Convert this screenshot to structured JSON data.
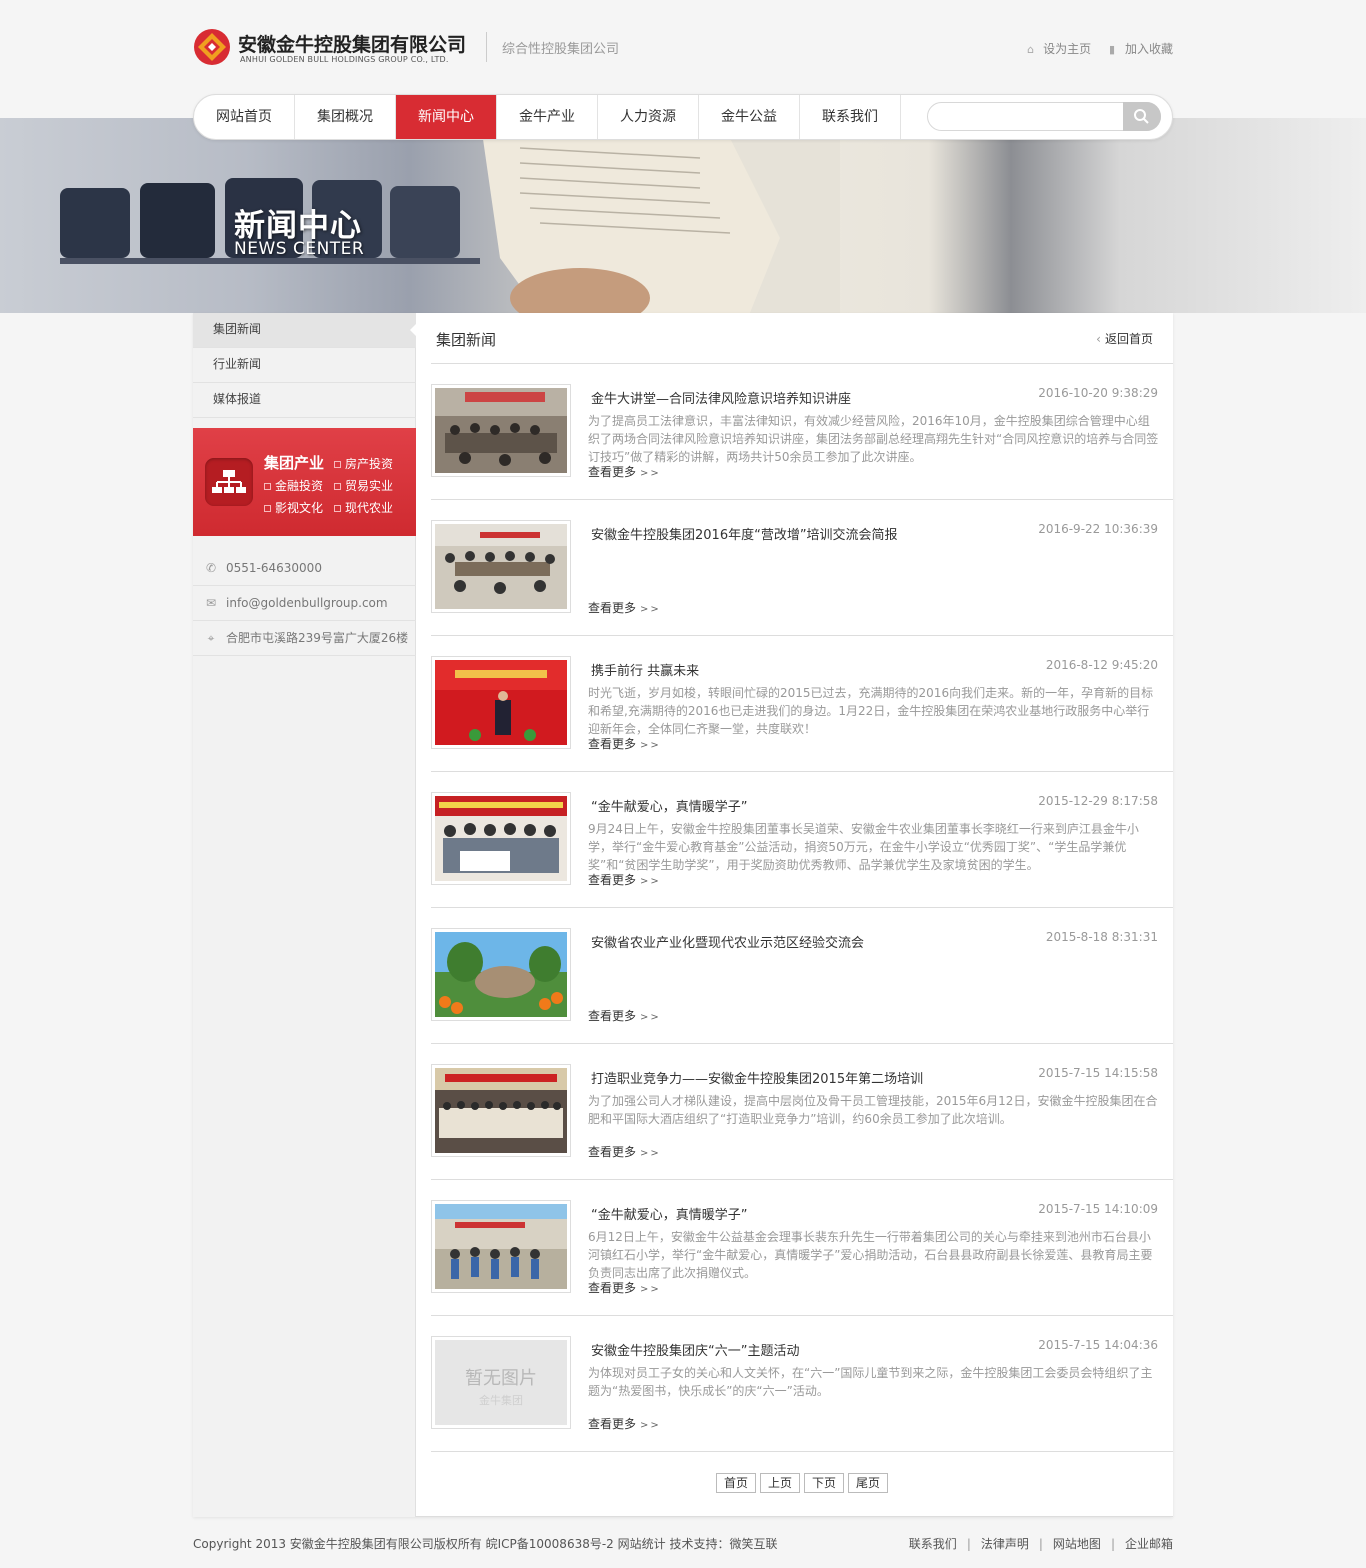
{
  "header": {
    "company_cn": "安徽金牛控股集团有限公司",
    "company_en": "ANHUI GOLDEN BULL HOLDINGS GROUP CO., LTD.",
    "slogan": "综合性控股集团公司",
    "set_home": "设为主页",
    "add_favorite": "加入收藏"
  },
  "nav": {
    "items": [
      "网站首页",
      "集团概况",
      "新闻中心",
      "金牛产业",
      "人力资源",
      "金牛公益",
      "联系我们"
    ],
    "active_index": 2,
    "search_placeholder": "",
    "accent_color": "#d82c33"
  },
  "banner": {
    "title": "新闻中心",
    "subtitle": "NEWS CENTER"
  },
  "sidebar": {
    "items": [
      "集团新闻",
      "行业新闻",
      "媒体报道"
    ],
    "active_index": 0,
    "industry": {
      "title": "集团产业",
      "links": [
        "房产投资",
        "金融投资",
        "贸易实业",
        "影视文化",
        "现代农业"
      ]
    },
    "contact": {
      "phone": "0551-64630000",
      "email": "info@goldenbullgroup.com",
      "address": "合肥市屯溪路239号富广大厦26楼"
    }
  },
  "content": {
    "section_title": "集团新闻",
    "back_home": "返回首页",
    "more_label": "查看更多",
    "news": [
      {
        "title": "金牛大讲堂—合同法律风险意识培养知识讲座",
        "date": "2016-10-20 9:38:29",
        "summary": "为了提高员工法律意识，丰富法律知识，有效减少经营风险，2016年10月，金牛控股集团综合管理中心组织了两场合同法律风险意识培养知识讲座，集团法务部副总经理高翔先生针对“合同风控意识的培养与合同签订技巧”做了精彩的讲解，两场共计50余员工参加了此次讲座。",
        "thumb": "meeting-room"
      },
      {
        "title": "安徽金牛控股集团2016年度“营改增”培训交流会简报",
        "date": "2016-9-22 10:36:39",
        "summary": "",
        "thumb": "training-room"
      },
      {
        "title": "携手前行 共赢未来",
        "date": "2016-8-12 9:45:20",
        "summary": "时光飞逝，岁月如梭，转眼间忙碌的2015已过去，充满期待的2016向我们走来。新的一年，孕育新的目标和希望,充满期待的2016也已走进我们的身边。1月22日，金牛控股集团在荣鸿农业基地行政服务中心举行迎新年会，全体同仁齐聚一堂，共度联欢！",
        "thumb": "red-stage"
      },
      {
        "title": "“金牛献爱心，真情暖学子”",
        "date": "2015-12-29 8:17:58",
        "summary": "9月24日上午，安徽金牛控股集团董事长吴道荣、安徽金牛农业集团董事长李晓红一行来到庐江县金牛小学，举行“金牛爱心教育基金”公益活动，捐资50万元，在金牛小学设立“优秀园丁奖”、“学生品学兼优奖”和“贫困学生助学奖”，用于奖励资助优秀教师、品学兼优学生及家境贫困的学生。",
        "thumb": "donation-group"
      },
      {
        "title": "安徽省农业产业化暨现代农业示范区经验交流会",
        "date": "2015-8-18 8:31:31",
        "summary": "",
        "thumb": "park-rock"
      },
      {
        "title": "打造职业竞争力——安徽金牛控股集团2015年第二场培训",
        "date": "2015-7-15 14:15:58",
        "summary": "为了加强公司人才梯队建设，提高中层岗位及骨干员工管理技能，2015年6月12日，安徽金牛控股集团在合肥和平国际大酒店组织了“打造职业竞争力”培训，约60余员工参加了此次培训。",
        "thumb": "group-photo"
      },
      {
        "title": "“金牛献爱心，真情暖学子”",
        "date": "2015-7-15 14:10:09",
        "summary": "6月12日上午，安徽金牛公益基金会理事长裴东升先生一行带着集团公司的关心与牵挂来到池州市石台县小河镇红石小学，举行“金牛献爱心，真情暖学子”爱心捐助活动，石台县县政府副县长徐爱莲、县教育局主要负责同志出席了此次捐赠仪式。",
        "thumb": "school-yard"
      },
      {
        "title": "安徽金牛控股集团庆“六一”主题活动",
        "date": "2015-7-15 14:04:36",
        "summary": "为体现对员工子女的关心和人文关怀，在“六一”国际儿童节到来之际，金牛控股集团工会委员会特组织了主题为“热爱图书，快乐成长”的庆“六一”活动。",
        "thumb": "no-image",
        "noimg_main": "暂无图片",
        "noimg_sub": "金牛集团"
      }
    ],
    "pager": [
      "首页",
      "上页",
      "下页",
      "尾页"
    ]
  },
  "footer": {
    "copyright": "Copyright 2013 安徽金牛控股集团有限公司版权所有 皖ICP备10008638号-2 网站统计 技术支持：微笑互联",
    "links": [
      "联系我们",
      "法律声明",
      "网站地图",
      "企业邮箱"
    ]
  }
}
